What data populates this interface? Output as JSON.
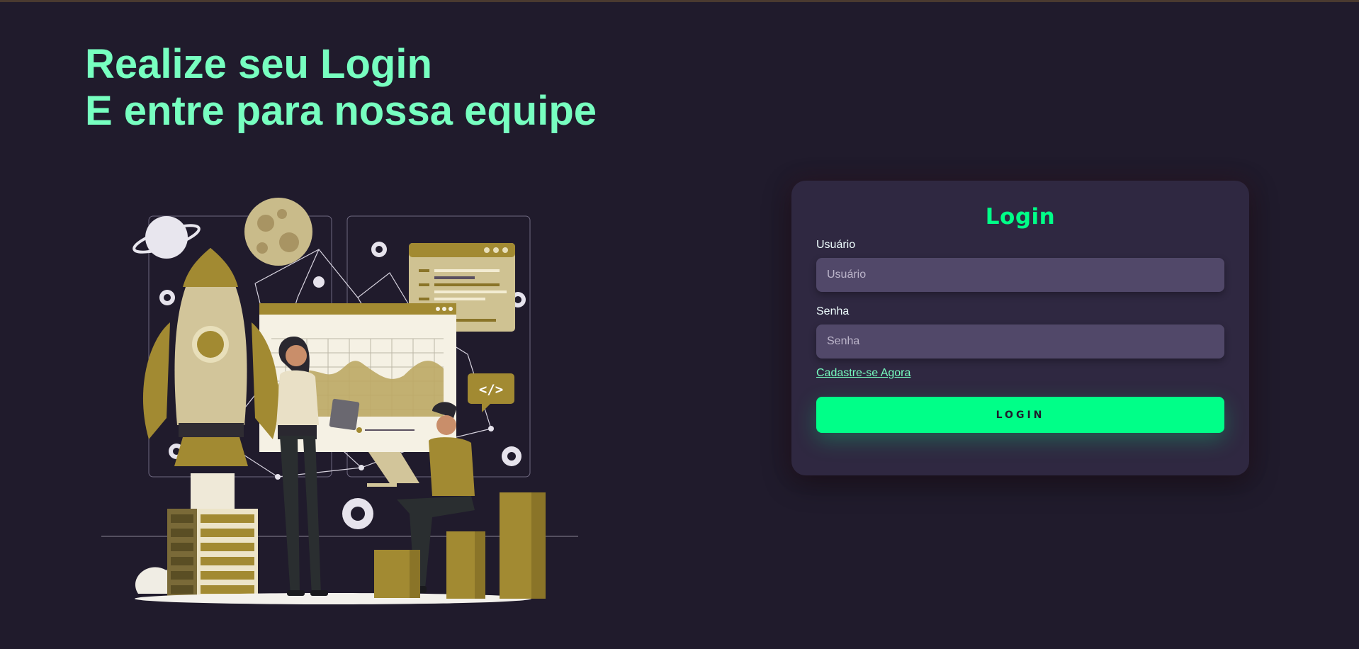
{
  "hero": {
    "line1": "Realize seu Login",
    "line2": "E entre para nossa equipe",
    "illustration_icon": "team-rocket-illustration",
    "accent_color": "#77ffc0"
  },
  "login_card": {
    "title": "Login",
    "username_label": "Usuário",
    "username_placeholder": "Usuário",
    "username_value": "",
    "password_label": "Senha",
    "password_placeholder": "Senha",
    "password_value": "",
    "signup_link": "Cadastre-se Agora",
    "submit_label": "Login",
    "button_color": "#00ff88",
    "card_color": "#2f2841",
    "input_color": "#514869"
  },
  "illustration_text": {
    "code_tag": "</>"
  }
}
